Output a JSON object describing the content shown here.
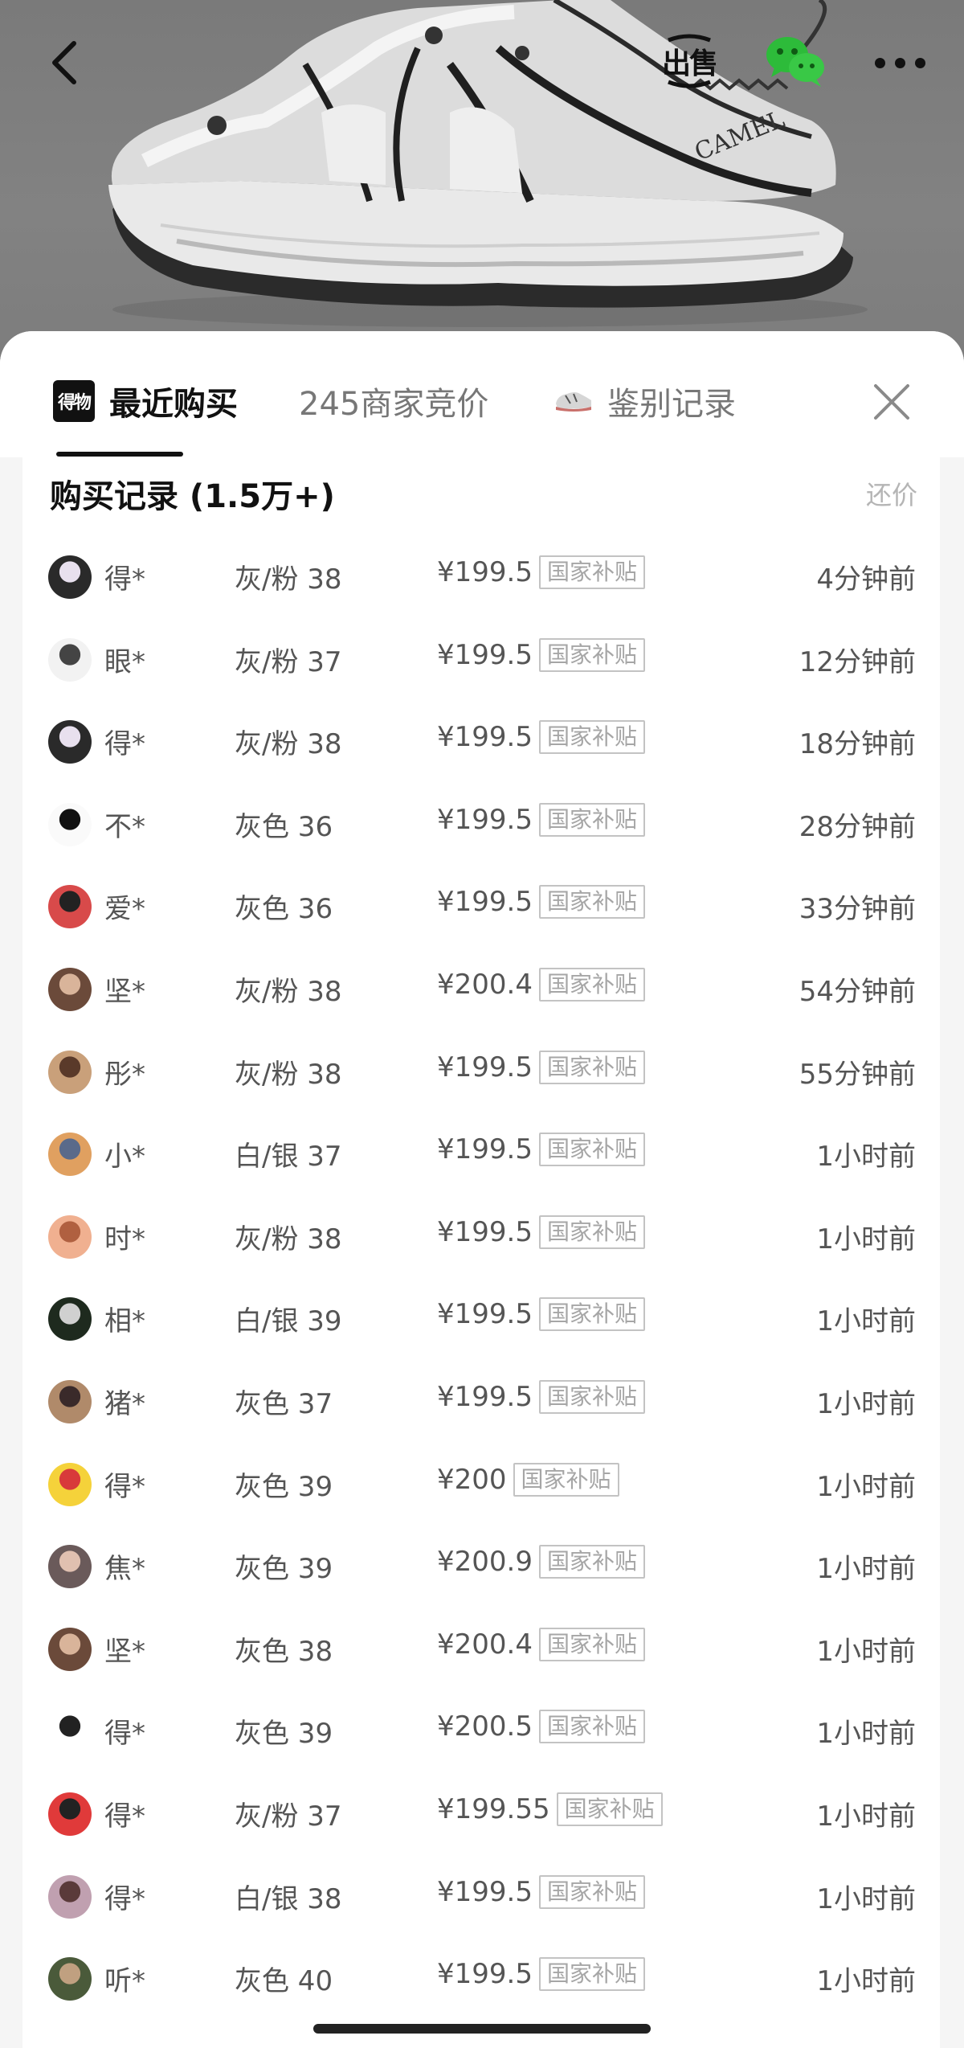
{
  "header": {
    "sell_label": "出售",
    "icons": {
      "back": "back-chevron-icon",
      "sell": "sell-icon",
      "share": "wechat-icon",
      "more": "more-dots-icon"
    }
  },
  "product": {
    "brand_text": "CAMEL"
  },
  "tabs": [
    {
      "label": "最近购买",
      "logo_text": "得物",
      "active": true
    },
    {
      "label": "245商家竞价",
      "active": false
    },
    {
      "label": "鉴别记录",
      "active": false
    }
  ],
  "panel": {
    "title": "购买记录 (1.5万+)",
    "counter_offer": "还价"
  },
  "colors": {
    "accent": "#111111",
    "badge_border": "#c3c3c3",
    "muted": "#b5b5b5"
  },
  "records": [
    {
      "buyer": "得*",
      "spec": "灰/粉 38",
      "price": "¥199.5",
      "badge": "国家补贴",
      "time": "4分钟前"
    },
    {
      "buyer": "眼*",
      "spec": "灰/粉 37",
      "price": "¥199.5",
      "badge": "国家补贴",
      "time": "12分钟前"
    },
    {
      "buyer": "得*",
      "spec": "灰/粉 38",
      "price": "¥199.5",
      "badge": "国家补贴",
      "time": "18分钟前"
    },
    {
      "buyer": "不*",
      "spec": "灰色 36",
      "price": "¥199.5",
      "badge": "国家补贴",
      "time": "28分钟前"
    },
    {
      "buyer": "爱*",
      "spec": "灰色 36",
      "price": "¥199.5",
      "badge": "国家补贴",
      "time": "33分钟前"
    },
    {
      "buyer": "坚*",
      "spec": "灰/粉 38",
      "price": "¥200.4",
      "badge": "国家补贴",
      "time": "54分钟前"
    },
    {
      "buyer": "彤*",
      "spec": "灰/粉 38",
      "price": "¥199.5",
      "badge": "国家补贴",
      "time": "55分钟前"
    },
    {
      "buyer": "小*",
      "spec": "白/银 37",
      "price": "¥199.5",
      "badge": "国家补贴",
      "time": "1小时前"
    },
    {
      "buyer": "时*",
      "spec": "灰/粉 38",
      "price": "¥199.5",
      "badge": "国家补贴",
      "time": "1小时前"
    },
    {
      "buyer": "相*",
      "spec": "白/银 39",
      "price": "¥199.5",
      "badge": "国家补贴",
      "time": "1小时前"
    },
    {
      "buyer": "猪*",
      "spec": "灰色 37",
      "price": "¥199.5",
      "badge": "国家补贴",
      "time": "1小时前"
    },
    {
      "buyer": "得*",
      "spec": "灰色 39",
      "price": "¥200",
      "badge": "国家补贴",
      "time": "1小时前"
    },
    {
      "buyer": "焦*",
      "spec": "灰色 39",
      "price": "¥200.9",
      "badge": "国家补贴",
      "time": "1小时前"
    },
    {
      "buyer": "坚*",
      "spec": "灰色 38",
      "price": "¥200.4",
      "badge": "国家补贴",
      "time": "1小时前"
    },
    {
      "buyer": "得*",
      "spec": "灰色 39",
      "price": "¥200.5",
      "badge": "国家补贴",
      "time": "1小时前"
    },
    {
      "buyer": "得*",
      "spec": "灰/粉 37",
      "price": "¥199.55",
      "badge": "国家补贴",
      "time": "1小时前"
    },
    {
      "buyer": "得*",
      "spec": "白/银 38",
      "price": "¥199.5",
      "badge": "国家补贴",
      "time": "1小时前"
    },
    {
      "buyer": "听*",
      "spec": "灰色 40",
      "price": "¥199.5",
      "badge": "国家补贴",
      "time": "1小时前"
    }
  ]
}
